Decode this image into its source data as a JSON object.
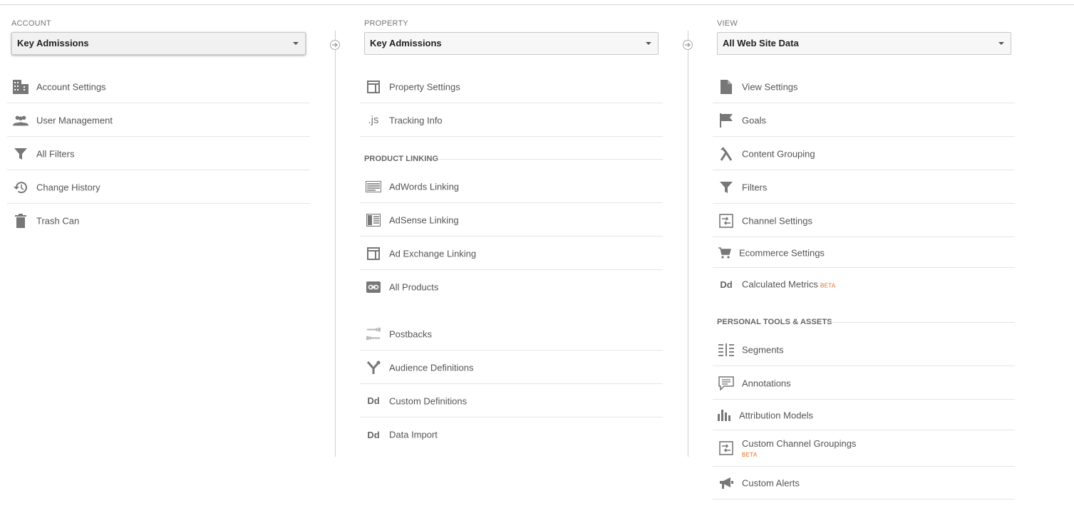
{
  "account": {
    "label": "ACCOUNT",
    "selected": "Key Admissions",
    "items": [
      {
        "icon": "building-icon",
        "label": "Account Settings"
      },
      {
        "icon": "people-icon",
        "label": "User Management"
      },
      {
        "icon": "filter-icon",
        "label": "All Filters"
      },
      {
        "icon": "history-icon",
        "label": "Change History"
      },
      {
        "icon": "trash-icon",
        "label": "Trash Can"
      }
    ]
  },
  "property": {
    "label": "PROPERTY",
    "selected": "Key Admissions",
    "items": [
      {
        "icon": "layout-icon",
        "label": "Property Settings"
      },
      {
        "icon": "js-icon",
        "label": "Tracking Info",
        "glyph": ".js"
      }
    ],
    "product_linking": {
      "heading": "PRODUCT LINKING",
      "items": [
        {
          "icon": "adwords-icon",
          "label": "AdWords Linking"
        },
        {
          "icon": "adsense-icon",
          "label": "AdSense Linking"
        },
        {
          "icon": "ad-exchange-icon",
          "label": "Ad Exchange Linking"
        },
        {
          "icon": "link-icon",
          "label": "All Products"
        }
      ]
    },
    "more_items": [
      {
        "icon": "postbacks-icon",
        "label": "Postbacks"
      },
      {
        "icon": "audience-icon",
        "label": "Audience Definitions"
      },
      {
        "icon": "dd-icon",
        "label": "Custom Definitions",
        "glyph": "Dd"
      },
      {
        "icon": "dd-icon",
        "label": "Data Import",
        "glyph": "Dd"
      }
    ]
  },
  "view": {
    "label": "VIEW",
    "selected": "All Web Site Data",
    "items": [
      {
        "icon": "document-icon",
        "label": "View Settings"
      },
      {
        "icon": "flag-icon",
        "label": "Goals"
      },
      {
        "icon": "content-grouping-icon",
        "label": "Content Grouping"
      },
      {
        "icon": "filter-icon",
        "label": "Filters"
      },
      {
        "icon": "channel-icon",
        "label": "Channel Settings"
      },
      {
        "icon": "cart-icon",
        "label": "Ecommerce Settings"
      },
      {
        "icon": "dd-icon",
        "label": "Calculated Metrics",
        "glyph": "Dd",
        "badge": "BETA"
      }
    ],
    "personal_tools": {
      "heading": "PERSONAL TOOLS & ASSETS",
      "items": [
        {
          "icon": "segments-icon",
          "label": "Segments"
        },
        {
          "icon": "annotation-icon",
          "label": "Annotations"
        },
        {
          "icon": "bar-chart-icon",
          "label": "Attribution Models"
        },
        {
          "icon": "channel-icon",
          "label": "Custom Channel Groupings",
          "badge": "BETA"
        },
        {
          "icon": "megaphone-icon",
          "label": "Custom Alerts"
        }
      ]
    }
  }
}
